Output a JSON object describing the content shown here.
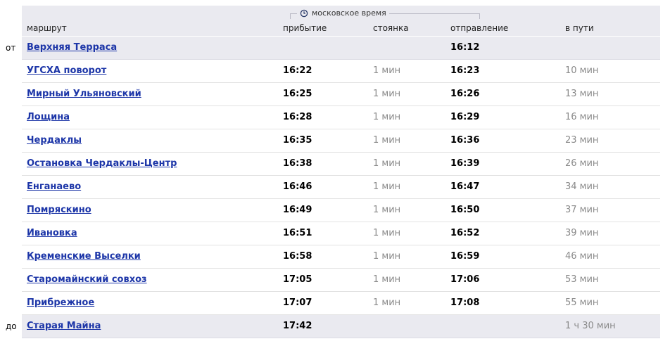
{
  "header": {
    "timezone_label": "московское время",
    "columns": {
      "route": "маршрут",
      "arrival": "прибытие",
      "stop": "стоянка",
      "departure": "отправление",
      "travel": "в пути"
    }
  },
  "labels": {
    "from": "от",
    "to": "до"
  },
  "rows": [
    {
      "station": "Верхняя Терраса",
      "arrival": "",
      "stop": "",
      "departure": "16:12",
      "travel": ""
    },
    {
      "station": "УГСХА поворот",
      "arrival": "16:22",
      "stop": "1 мин",
      "departure": "16:23",
      "travel": "10 мин"
    },
    {
      "station": "Мирный Ульяновский",
      "arrival": "16:25",
      "stop": "1 мин",
      "departure": "16:26",
      "travel": "13 мин"
    },
    {
      "station": "Лощина",
      "arrival": "16:28",
      "stop": "1 мин",
      "departure": "16:29",
      "travel": "16 мин"
    },
    {
      "station": "Чердаклы",
      "arrival": "16:35",
      "stop": "1 мин",
      "departure": "16:36",
      "travel": "23 мин"
    },
    {
      "station": "Остановка Чердаклы-Центр",
      "arrival": "16:38",
      "stop": "1 мин",
      "departure": "16:39",
      "travel": "26 мин"
    },
    {
      "station": "Енганаево",
      "arrival": "16:46",
      "stop": "1 мин",
      "departure": "16:47",
      "travel": "34 мин"
    },
    {
      "station": "Помряскино",
      "arrival": "16:49",
      "stop": "1 мин",
      "departure": "16:50",
      "travel": "37 мин"
    },
    {
      "station": "Ивановка",
      "arrival": "16:51",
      "stop": "1 мин",
      "departure": "16:52",
      "travel": "39 мин"
    },
    {
      "station": "Кременские Выселки",
      "arrival": "16:58",
      "stop": "1 мин",
      "departure": "16:59",
      "travel": "46 мин"
    },
    {
      "station": "Старомайнский совхоз",
      "arrival": "17:05",
      "stop": "1 мин",
      "departure": "17:06",
      "travel": "53 мин"
    },
    {
      "station": "Прибрежное",
      "arrival": "17:07",
      "stop": "1 мин",
      "departure": "17:08",
      "travel": "55 мин"
    },
    {
      "station": "Старая Майна",
      "arrival": "17:42",
      "stop": "",
      "departure": "",
      "travel": "1 ч 30 мин"
    }
  ],
  "icons": {
    "timezone": "clock-icon"
  },
  "colors": {
    "link": "#1d36a8",
    "muted": "#8a8a8a",
    "header_bg": "#eaeaf0"
  }
}
